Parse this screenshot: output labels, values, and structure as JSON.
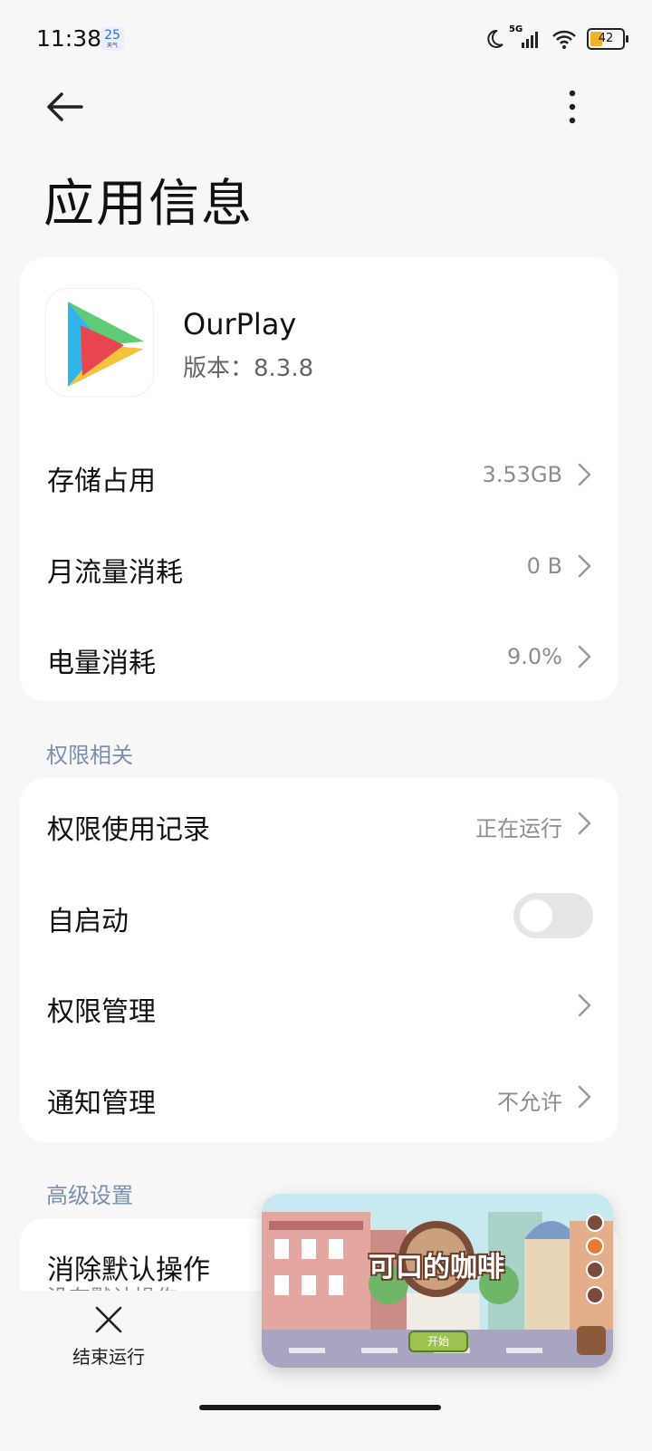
{
  "status": {
    "time": "11:38",
    "date_badge": "25",
    "network": "5G",
    "battery_level": "42",
    "battery_fraction": 0.42
  },
  "header": {
    "title": "应用信息"
  },
  "app": {
    "name": "OurPlay",
    "version": "版本：8.3.8"
  },
  "usage": [
    {
      "label": "存储占用",
      "value": "3.53GB"
    },
    {
      "label": "月流量消耗",
      "value": "0 B"
    },
    {
      "label": "电量消耗",
      "value": "9.0%"
    }
  ],
  "permissions": {
    "section_title": "权限相关",
    "items": [
      {
        "label": "权限使用记录",
        "value": "正在运行"
      },
      {
        "label": "自启动",
        "toggle_on": false
      },
      {
        "label": "权限管理",
        "value": ""
      },
      {
        "label": "通知管理",
        "value": "不允许"
      }
    ]
  },
  "advanced": {
    "section_title": "高级设置",
    "items": [
      {
        "label": "消除默认操作",
        "sub": "没有默认操作"
      }
    ]
  },
  "bottom": {
    "end_label": "结束运行"
  },
  "pip": {
    "title": "可口的咖啡",
    "start_label": "开始"
  },
  "colors": {
    "background": "#f7f7f7",
    "card": "#ffffff",
    "section": "#7a8fb0",
    "value": "#8d8d8d"
  }
}
